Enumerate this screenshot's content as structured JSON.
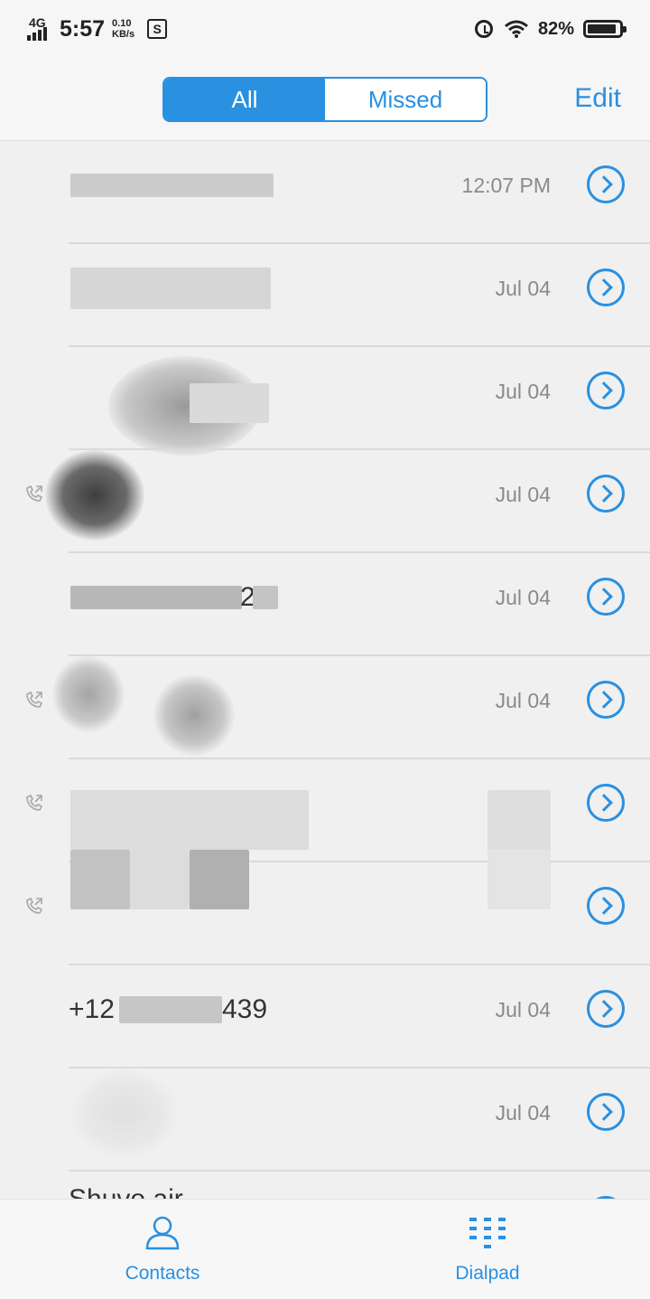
{
  "status_bar": {
    "network": "4G",
    "time": "5:57",
    "speed_value": "0.10",
    "speed_unit": "KB/s",
    "sim_icon": "s-icon",
    "battery": "82%"
  },
  "header": {
    "tabs": [
      {
        "label": "All",
        "active": true
      },
      {
        "label": "Missed",
        "active": false
      }
    ],
    "edit_label": "Edit"
  },
  "calls": [
    {
      "name": "",
      "time": "12:07 PM"
    },
    {
      "name": "",
      "time": "Jul 04"
    },
    {
      "name": "",
      "time": "Jul 04"
    },
    {
      "name": "",
      "time": "Jul 04"
    },
    {
      "name": "2",
      "time": "Jul 04"
    },
    {
      "name": "",
      "time": "Jul 04"
    },
    {
      "name": "",
      "time": ""
    },
    {
      "name": "",
      "time": ""
    },
    {
      "name": "+12",
      "name_suffix": "439",
      "time": "Jul 04"
    },
    {
      "name": "",
      "time": "Jul 04"
    },
    {
      "name": "Shuvo air",
      "time": ""
    }
  ],
  "bottom_nav": {
    "contacts_label": "Contacts",
    "dialpad_label": "Dialpad"
  },
  "colors": {
    "accent": "#2a90e0",
    "background": "#f0f0f0",
    "divider": "#dadada",
    "muted_text": "#8a8a8a"
  }
}
